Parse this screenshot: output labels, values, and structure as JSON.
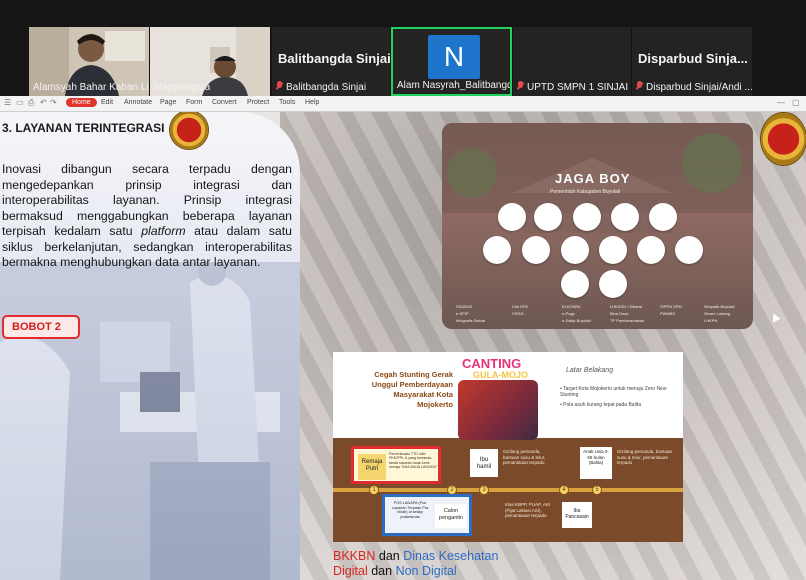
{
  "participants": [
    {
      "name": "Alamsyah Bahar Kaban Lit...",
      "muted": false
    },
    {
      "name": "Mappangara",
      "muted": false
    },
    {
      "display": "Balitbangda Sinjai",
      "name": "Balitbangda Sinjai",
      "muted": true
    },
    {
      "avatar_letter": "N",
      "name": "Alam Nasyrah_Balitbangda",
      "muted": false,
      "speaking": true
    },
    {
      "name": "UPTD SMPN 1 SINJAI",
      "muted": true
    },
    {
      "display": "Disparbud  Sinja...",
      "name": "Disparbud Sinjai/Andi ...",
      "muted": true
    }
  ],
  "toolbar": {
    "active": "Home",
    "items": [
      "Edit",
      "Annotate",
      "Page",
      "Form",
      "Convert",
      "Protect",
      "Tools",
      "Help"
    ]
  },
  "slide": {
    "section_title": "3. LAYANAN TERINTEGRASI",
    "body": {
      "part1": "Inovasi dibangun secara terpadu dengan mengedepankan prinsip integrasi dan interoperabilitas layanan. Prinsip integrasi bermaksud menggabungkan beberapa layanan terpisah kedalam satu ",
      "platform": "platform",
      "part2": " atau dalam satu siklus berkelanjutan, sedangkan interoperabilitas bermakna menghubungkan data antar layanan."
    },
    "badge": "BOBOT 2",
    "jaga": {
      "logo": "JAGA BOY",
      "subtitle": "Pemerintah Kabupaten Boyolali",
      "captions": [
        "SIGADIS",
        "e-SPIP",
        "Infografis Sekda",
        "Cek KPK",
        "SIPAS",
        "ELKONPA",
        "e-Pogs",
        "e-Sakip Boyolali",
        "LHKASN / Siharta",
        "Bina Desa",
        "TP Pemberantasan",
        "SIPPN SPM",
        "PWMBS",
        "Simpatik Boyolali",
        "Sinaro Lobang",
        "LHKPN"
      ]
    },
    "canting": {
      "title_a": "CANTING",
      "title_b": "GULA-MOJO",
      "left_text": "Cegah Stunting Gerak Unggul Pemberdayaan Masyarakat Kota Mojokerto",
      "latar": "Latar Belakang",
      "bullet1": "Target Kota Mojokerto untuk menuju Zero New Stunting",
      "bullet2": "Pola asuh kurang tepat pada Balita",
      "remaja": "Remaja Putri",
      "remaja_note": "Pemeriksaan TTD oleh PKK/PPL & yang bertanda-tanda sasaran anak Anne remaja \"AHA MAJA LANGKIS\"",
      "ibu_hamil": "Ibu hamil",
      "ibu_hamil_note": "Gizilang pemanda, bantuan susu & telur, pemantauan terpadu",
      "anak": "Anak Usia 0-59 bulan (Balita)",
      "anak_note": "Gizilang pemanda, bantuan susu & telur, pemantauan terpadu",
      "pos": "POS LADAPA (Pos Layanan Terpadu Pra nikah) di setiap puskesmas",
      "calon": "Calon pengantin",
      "ibu_pancasaya": "Ibu Pancasain",
      "ibu_pancasaya_note": "Klas KBPP, PUAP, AKI (Pijat Laktasi ASI), pemantauan terpadu",
      "numbers": [
        "1",
        "2",
        "3",
        "4",
        "5"
      ]
    },
    "footer": {
      "line1_a": "BKKBN",
      "line1_b": " dan ",
      "line1_c": "Dinas Kesehatan",
      "line2_a": "Digital",
      "line2_b": " dan ",
      "line2_c": "Non Digital"
    },
    "colors": {
      "red": "#e0352b",
      "blue": "#1f74cc",
      "brown": "#7a4a2a",
      "gold": "#d8a33c"
    }
  }
}
